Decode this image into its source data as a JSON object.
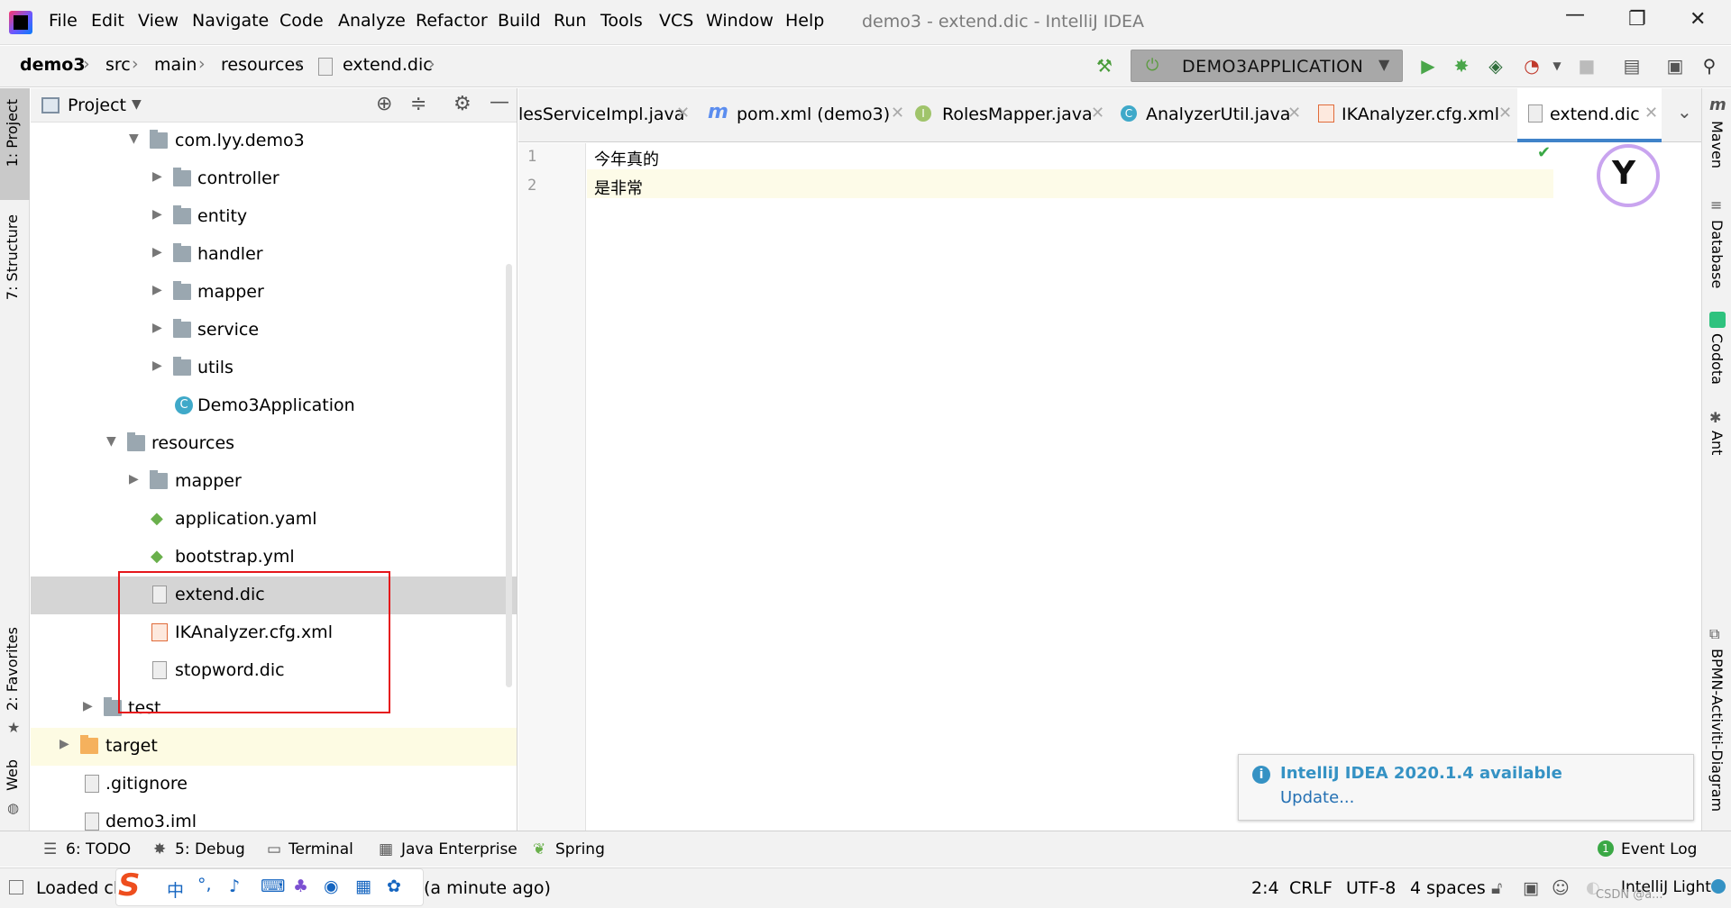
{
  "window": {
    "title": "demo3 - extend.dic - IntelliJ IDEA",
    "menu": [
      {
        "label": "File"
      },
      {
        "label": "Edit"
      },
      {
        "label": "View"
      },
      {
        "label": "Navigate"
      },
      {
        "label": "Code"
      },
      {
        "label": "Analyze"
      },
      {
        "label": "Refactor"
      },
      {
        "label": "Build"
      },
      {
        "label": "Run"
      },
      {
        "label": "Tools"
      },
      {
        "label": "VCS"
      },
      {
        "label": "Window"
      },
      {
        "label": "Help"
      }
    ]
  },
  "breadcrumb": [
    "demo3",
    "src",
    "main",
    "resources",
    "extend.dic"
  ],
  "run_config": {
    "label": "DEMO3APPLICATION"
  },
  "left_stripe": {
    "project": "1: Project",
    "structure": "7: Structure",
    "favorites": "2: Favorites",
    "web": "Web"
  },
  "right_stripe": {
    "maven": "Maven",
    "database": "Database",
    "codota": "Codota",
    "ant": "Ant",
    "bpmn": "BPMN-Activiti-Diagram"
  },
  "project_panel": {
    "title": "Project",
    "tree": [
      {
        "label": "com.lyy.demo3",
        "kind": "package",
        "expanded": true
      },
      {
        "label": "controller",
        "kind": "package"
      },
      {
        "label": "entity",
        "kind": "package"
      },
      {
        "label": "handler",
        "kind": "package"
      },
      {
        "label": "mapper",
        "kind": "package"
      },
      {
        "label": "service",
        "kind": "package"
      },
      {
        "label": "utils",
        "kind": "package"
      },
      {
        "label": "Demo3Application",
        "kind": "spring-class"
      },
      {
        "label": "resources",
        "kind": "resources-folder",
        "expanded": true
      },
      {
        "label": "mapper",
        "kind": "folder"
      },
      {
        "label": "application.yaml",
        "kind": "spring-yaml"
      },
      {
        "label": "bootstrap.yml",
        "kind": "spring-yaml"
      },
      {
        "label": "extend.dic",
        "kind": "dic-file",
        "selected": true
      },
      {
        "label": "IKAnalyzer.cfg.xml",
        "kind": "xml-file"
      },
      {
        "label": "stopword.dic",
        "kind": "dic-file"
      },
      {
        "label": "test",
        "kind": "folder"
      },
      {
        "label": "target",
        "kind": "excluded-folder"
      },
      {
        "label": ".gitignore",
        "kind": "file"
      },
      {
        "label": "demo3.iml",
        "kind": "file"
      }
    ]
  },
  "tabs": [
    {
      "label": "lesServiceImpl.java"
    },
    {
      "label": "pom.xml (demo3)"
    },
    {
      "label": "RolesMapper.java"
    },
    {
      "label": "AnalyzerUtil.java"
    },
    {
      "label": "IKAnalyzer.cfg.xml"
    },
    {
      "label": "extend.dic",
      "active": true
    }
  ],
  "editor": {
    "lines": [
      {
        "num": "1",
        "text": "今年真的"
      },
      {
        "num": "2",
        "text": "是非常"
      }
    ]
  },
  "notification": {
    "title": "IntelliJ IDEA 2020.1.4 available",
    "action": "Update..."
  },
  "bottom_tools": {
    "todo": "6: TODO",
    "debug": "5: Debug",
    "terminal": "Terminal",
    "java_enterprise": "Java Enterprise",
    "spring": "Spring",
    "event_log": "Event Log"
  },
  "status": {
    "message_start": "Loaded cla",
    "message_end": "(a minute ago)",
    "position": "2:4",
    "line_sep": "CRLF",
    "encoding": "UTF-8",
    "indent": "4 spaces",
    "theme": "IntelliJ Light",
    "watermark": "CSDN @a..."
  },
  "colors": {
    "accent": "#4083c9",
    "selection_box": "#e5171b",
    "info": "#3592c4"
  }
}
